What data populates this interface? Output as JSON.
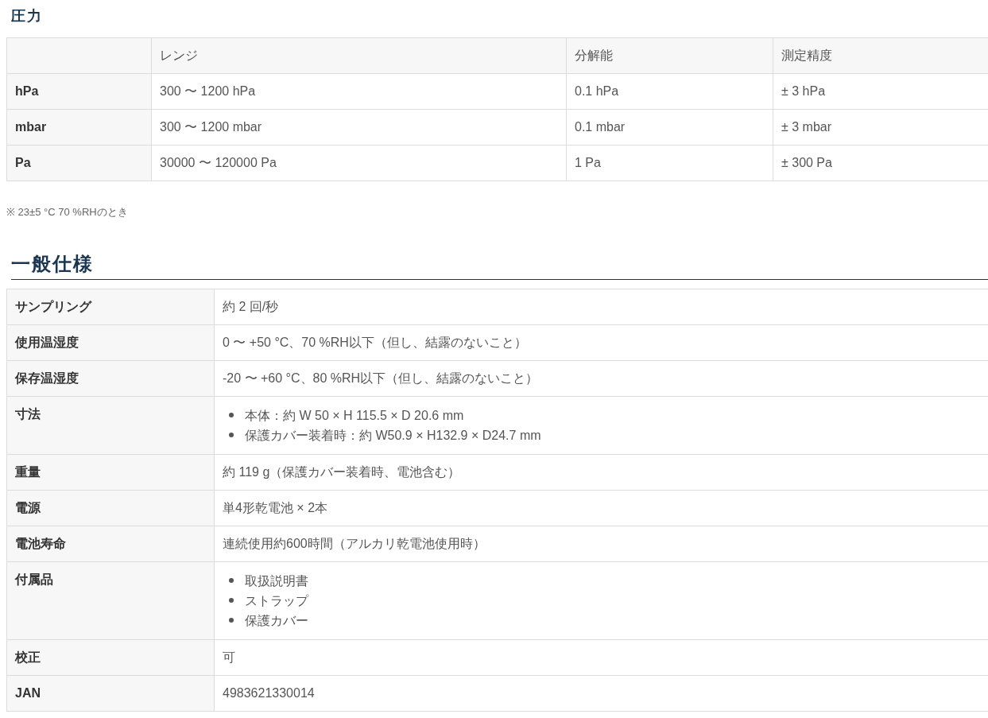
{
  "pressure": {
    "title": "圧力",
    "columns": [
      "レンジ",
      "分解能",
      "測定精度"
    ],
    "rows": [
      {
        "unit": "hPa",
        "cells": [
          "300 〜 1200 hPa",
          "0.1 hPa",
          "± 3 hPa"
        ]
      },
      {
        "unit": "mbar",
        "cells": [
          "300 〜 1200 mbar",
          "0.1 mbar",
          "± 3 mbar"
        ]
      },
      {
        "unit": "Pa",
        "cells": [
          "30000 〜 120000 Pa",
          "1 Pa",
          "± 300 Pa"
        ]
      }
    ],
    "note": "※ 23±5 °C 70 %RHのとき"
  },
  "general": {
    "title": "一般仕様",
    "rows": [
      {
        "label": "サンプリング",
        "kind": "text",
        "value": "約 2 回/秒"
      },
      {
        "label": "使用温湿度",
        "kind": "text",
        "value": "0 〜 +50 °C、70 %RH以下（但し、結露のないこと）"
      },
      {
        "label": "保存温湿度",
        "kind": "text",
        "value": "-20 〜 +60 °C、80 %RH以下（但し、結露のないこと）"
      },
      {
        "label": "寸法",
        "kind": "list",
        "items": [
          "本体：約 W 50 × H 115.5 × D 20.6 mm",
          "保護カバー装着時：約 W50.9 × H132.9 × D24.7 mm"
        ]
      },
      {
        "label": "重量",
        "kind": "text",
        "value": "約 119 g（保護カバー装着時、電池含む）"
      },
      {
        "label": "電源",
        "kind": "text",
        "value": "単4形乾電池 × 2本"
      },
      {
        "label": "電池寿命",
        "kind": "text",
        "value": "連続使用約600時間（アルカリ乾電池使用時）"
      },
      {
        "label": "付属品",
        "kind": "list",
        "items": [
          "取扱説明書",
          "ストラップ",
          "保護カバー"
        ]
      },
      {
        "label": "校正",
        "kind": "text",
        "value": "可"
      },
      {
        "label": "JAN",
        "kind": "text",
        "value": "4983621330014"
      }
    ]
  }
}
